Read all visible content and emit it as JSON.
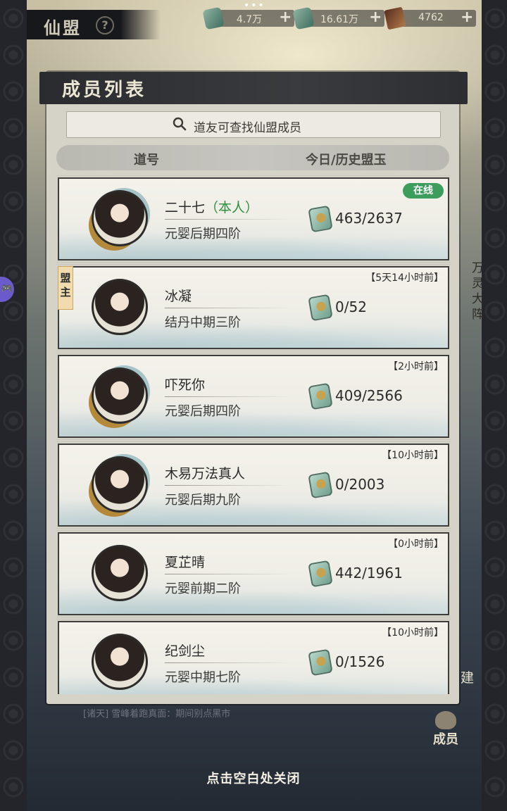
{
  "top_bar": {
    "title": "仙盟",
    "help_label": "?",
    "currencies": [
      {
        "icon": "jade-stone-icon",
        "value": "4.7万",
        "plus": "+"
      },
      {
        "icon": "spirit-stone-icon",
        "value": "16.61万",
        "plus": "+"
      },
      {
        "icon": "scroll-icon",
        "value": "4762",
        "plus": "+"
      }
    ]
  },
  "panel": {
    "title": "成员列表",
    "search_placeholder": "道友可查找仙盟成员",
    "columns": {
      "name": "道号",
      "jade": "今日/历史盟玉"
    }
  },
  "members": [
    {
      "name": "二十七",
      "self_tag": "（本人）",
      "realm": "元婴后期四阶",
      "jade": "463/2637",
      "status": "在线",
      "online": true,
      "leader": false
    },
    {
      "name": "冰凝",
      "self_tag": "",
      "realm": "结丹中期三阶",
      "jade": "0/52",
      "status": "【5天14小时前】",
      "online": false,
      "leader": true,
      "leader_label": "盟主"
    },
    {
      "name": "吓死你",
      "self_tag": "",
      "realm": "元婴后期四阶",
      "jade": "409/2566",
      "status": "【2小时前】",
      "online": false,
      "leader": false
    },
    {
      "name": "木易万法真人",
      "self_tag": "",
      "realm": "元婴后期九阶",
      "jade": "0/2003",
      "status": "【10小时前】",
      "online": false,
      "leader": false
    },
    {
      "name": "夏芷晴",
      "self_tag": "",
      "realm": "元婴前期二阶",
      "jade": "442/1961",
      "status": "【0小时前】",
      "online": false,
      "leader": false
    },
    {
      "name": "纪剑尘",
      "self_tag": "",
      "realm": "元婴中期七阶",
      "jade": "0/1526",
      "status": "【10小时前】",
      "online": false,
      "leader": false
    }
  ],
  "background": {
    "news": "[诸天] 雪峰着跑真面：期间别点黑市",
    "right_deco": "万灵大阵",
    "build_label": "建",
    "members_label": "成员"
  },
  "footer": {
    "close_hint": "点击空白处关闭"
  },
  "colors": {
    "online_badge": "#3c9d5c",
    "self_tag": "#2f8f3e",
    "header": "#2a2b2e"
  }
}
